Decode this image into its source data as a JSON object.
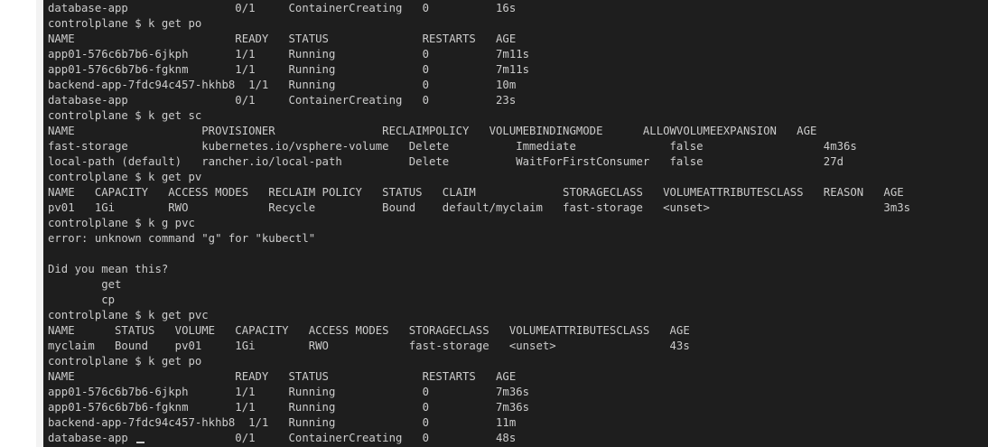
{
  "terminal": {
    "lines": [
      "database-app                0/1     ContainerCreating   0          16s",
      "controlplane $ k get po",
      "NAME                        READY   STATUS              RESTARTS   AGE",
      "app01-576c6b7b6-6jkph       1/1     Running             0          7m11s",
      "app01-576c6b7b6-fgknm       1/1     Running             0          7m11s",
      "backend-app-7fdc94c457-hkhb8  1/1   Running             0          10m",
      "database-app                0/1     ContainerCreating   0          23s",
      "controlplane $ k get sc",
      "NAME                   PROVISIONER                RECLAIMPOLICY   VOLUMEBINDINGMODE      ALLOWVOLUMEEXPANSION   AGE",
      "fast-storage           kubernetes.io/vsphere-volume   Delete          Immediate              false                  4m36s",
      "local-path (default)   rancher.io/local-path          Delete          WaitForFirstConsumer   false                  27d",
      "controlplane $ k get pv",
      "NAME   CAPACITY   ACCESS MODES   RECLAIM POLICY   STATUS   CLAIM             STORAGECLASS   VOLUMEATTRIBUTESCLASS   REASON   AGE",
      "pv01   1Gi        RWO            Recycle          Bound    default/myclaim   fast-storage   <unset>                          3m3s",
      "controlplane $ k g pvc",
      "error: unknown command \"g\" for \"kubectl\"",
      "",
      "Did you mean this?",
      "        get",
      "        cp",
      "controlplane $ k get pvc",
      "NAME      STATUS   VOLUME   CAPACITY   ACCESS MODES   STORAGECLASS   VOLUMEATTRIBUTESCLASS   AGE",
      "myclaim   Bound    pv01     1Gi        RWO            fast-storage   <unset>                 43s",
      "controlplane $ k get po",
      "NAME                        READY   STATUS              RESTARTS   AGE",
      "app01-576c6b7b6-6jkph       1/1     Running             0          7m36s",
      "app01-576c6b7b6-fgknm       1/1     Running             0          7m36s",
      "backend-app-7fdc94c457-hkhb8  1/1   Running             0          11m",
      "database-app                0/1     ContainerCreating   0          48s"
    ]
  },
  "colors": {
    "terminal_background": "#1e1e1e",
    "terminal_text": "#cccccc"
  }
}
